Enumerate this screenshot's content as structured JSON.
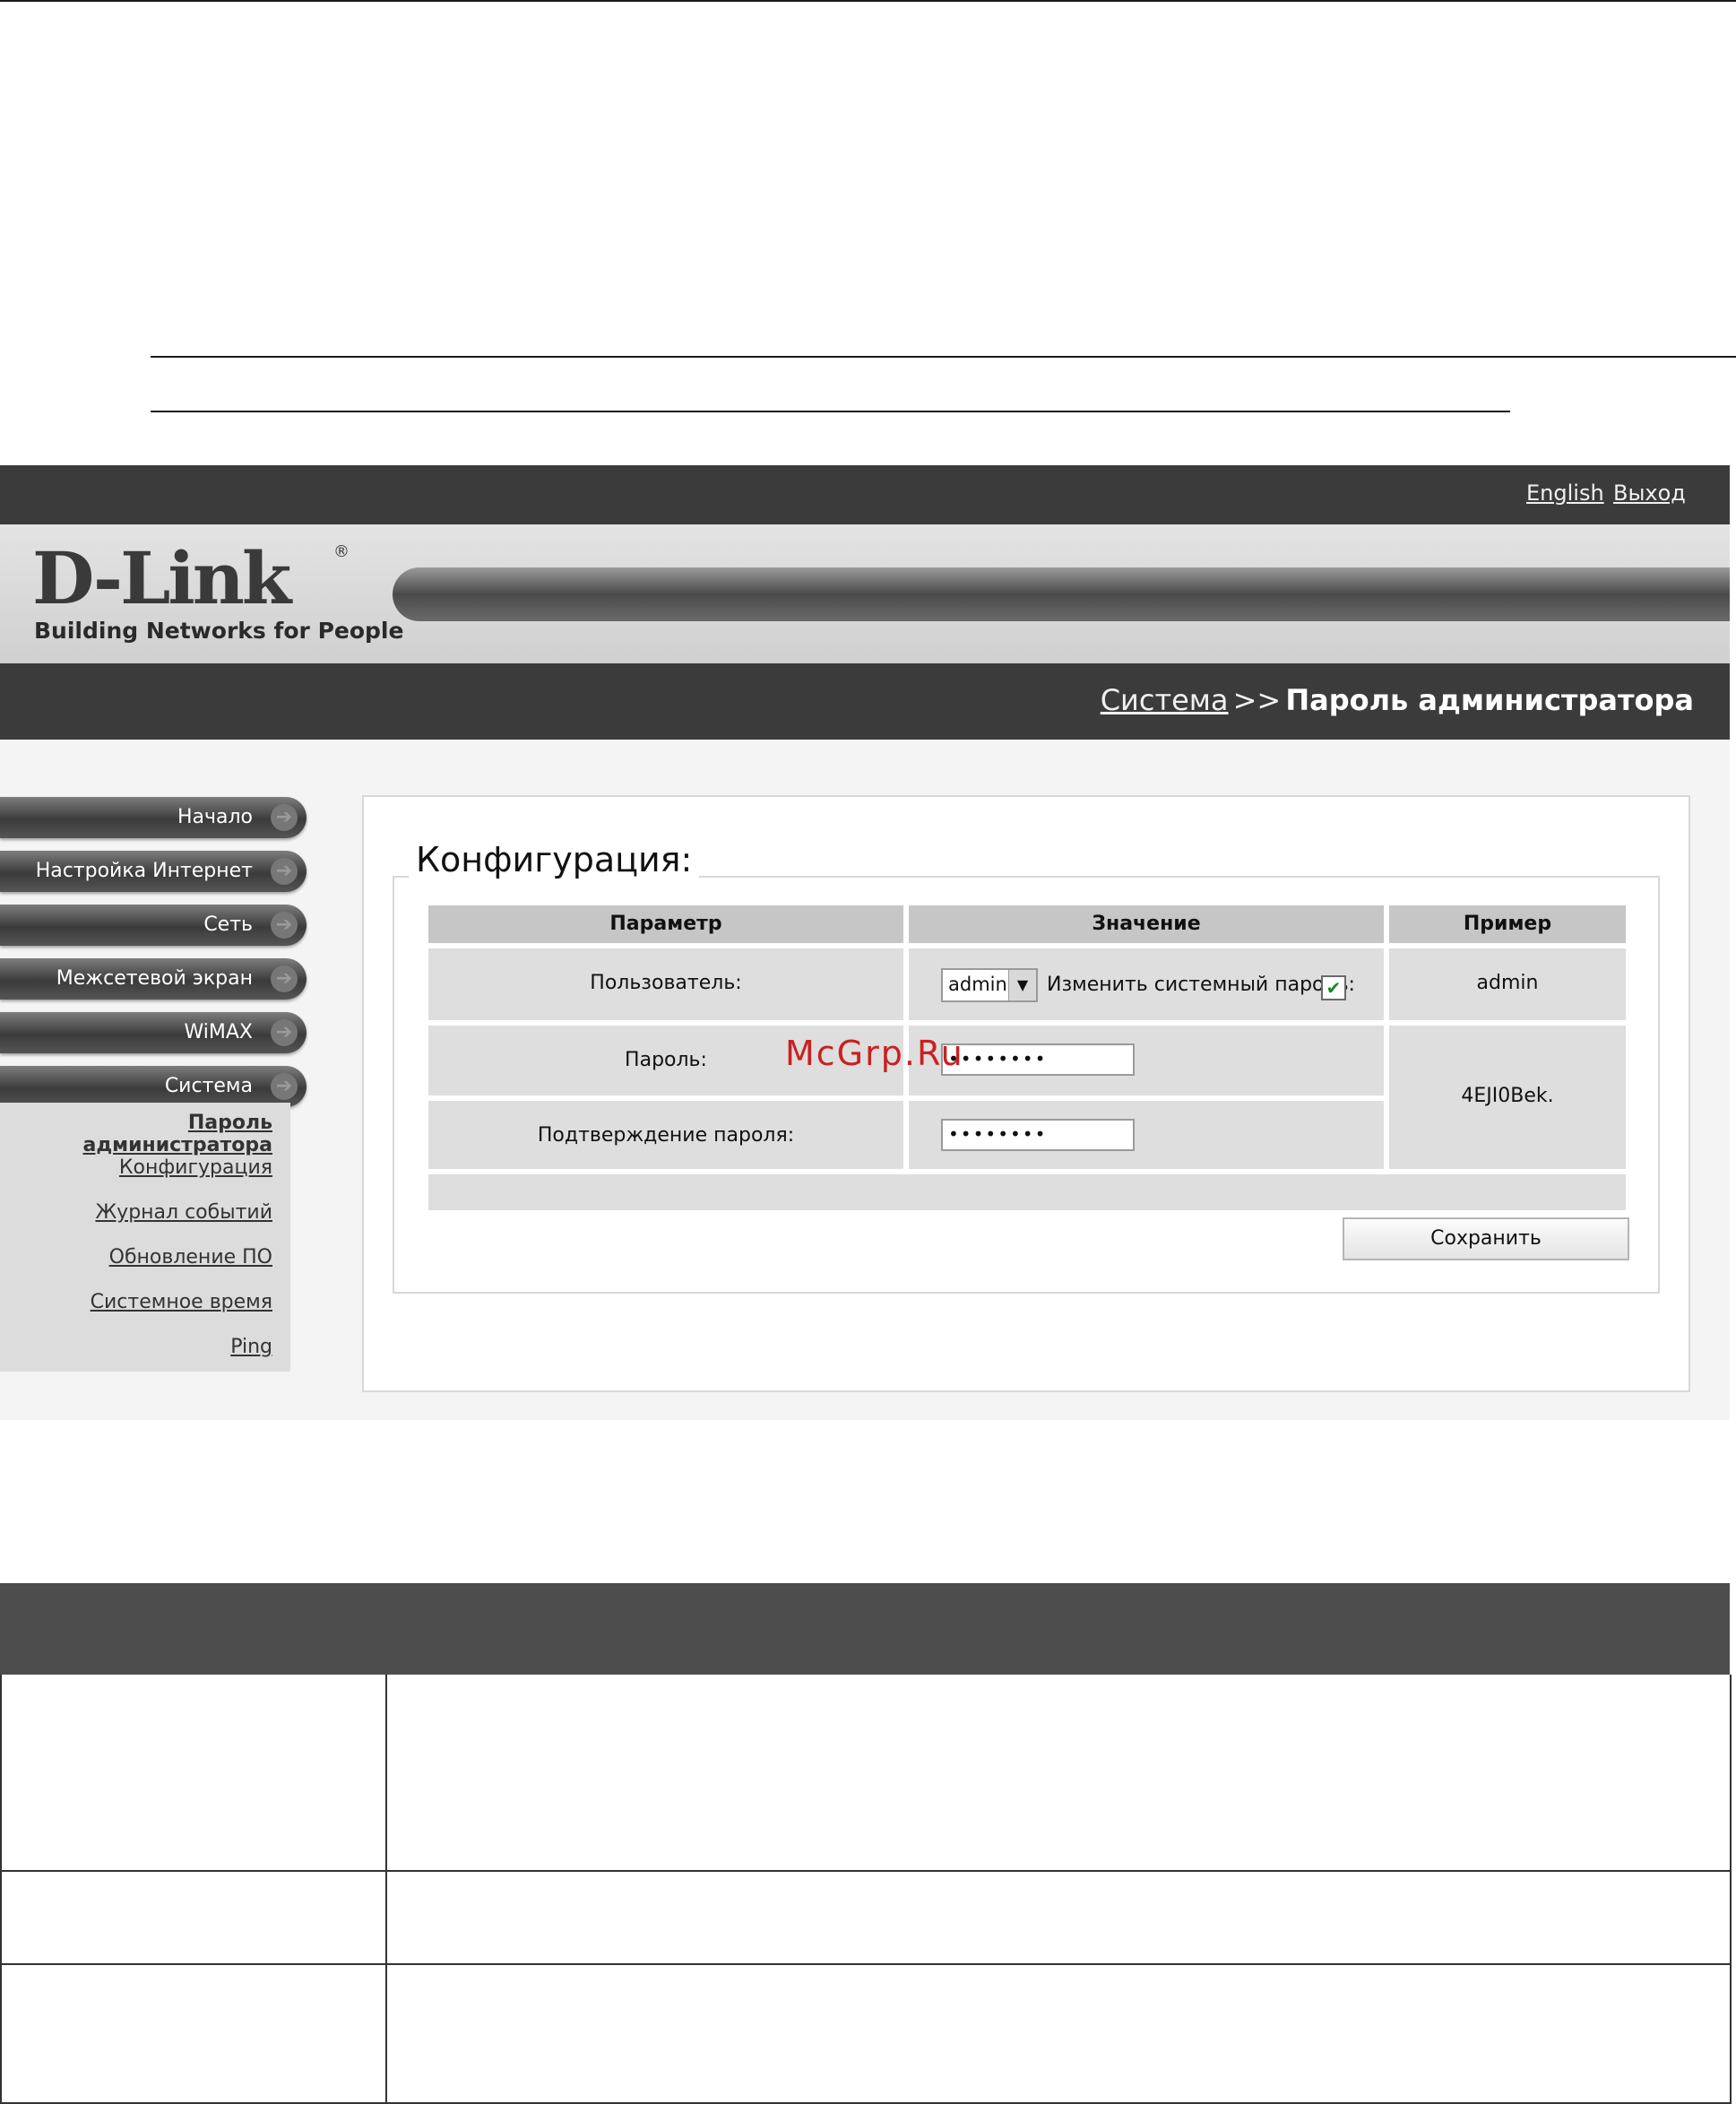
{
  "topbar": {
    "links": [
      "English",
      "Выход"
    ]
  },
  "logo": {
    "brand": "D-Link",
    "registered": "®",
    "tagline": "Building Networks for People"
  },
  "breadcrumb": {
    "parent": "Система",
    "separator": ">>",
    "current": "Пароль администратора"
  },
  "sidebar": {
    "items": [
      "Начало",
      "Настройка Интернет",
      "Сеть",
      "Межсетевой экран",
      "WiMAX",
      "Система"
    ],
    "subitems": [
      "Пароль администратора",
      "Конфигурация",
      "Журнал событий",
      "Обновление ПО",
      "Системное время",
      "Ping"
    ],
    "active_subitem": "Пароль администратора"
  },
  "config": {
    "legend": "Конфигурация:",
    "headers": [
      "Параметр",
      "Значение",
      "Пример"
    ],
    "user_label": "Пользователь:",
    "user_value": "admin",
    "change_password_label": "Изменить системный пароль:",
    "change_password_checked": true,
    "user_example": "admin",
    "password_label": "Пароль:",
    "password_value": "••••••••",
    "confirm_label": "Подтверждение пароля:",
    "confirm_value": "••••••••",
    "password_example": "4EJI0Bek.",
    "save_label": "Сохранить"
  },
  "watermark": "McGrp.Ru",
  "icons": {
    "arrow": "arrow-right-icon",
    "check": "checkmark-icon",
    "dropdown": "chevron-down-icon"
  }
}
